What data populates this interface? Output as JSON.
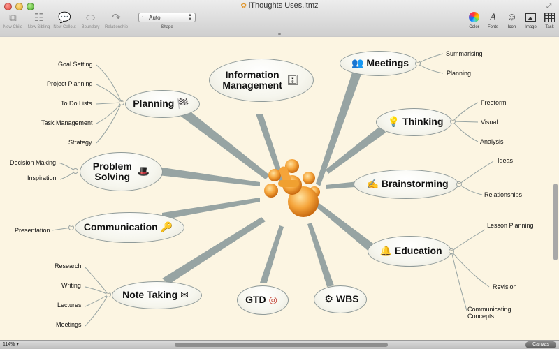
{
  "window": {
    "title": "iThoughts Uses.itmz"
  },
  "toolbar": {
    "left_tools": [
      {
        "id": "new-child",
        "label": "New Child",
        "icon": "new-child-icon",
        "glyph": "⧉"
      },
      {
        "id": "new-sibling",
        "label": "New Sibling",
        "icon": "new-sibling-icon",
        "glyph": "☷"
      },
      {
        "id": "new-callout",
        "label": "New Callout",
        "icon": "callout-icon",
        "glyph": "💬"
      },
      {
        "id": "boundary",
        "label": "Boundary",
        "icon": "boundary-icon",
        "glyph": "⬭"
      },
      {
        "id": "relationship",
        "label": "Relationship",
        "icon": "relationship-icon",
        "glyph": "↷"
      }
    ],
    "shape": {
      "value": "Auto",
      "label": "Shape"
    },
    "right_tools": [
      {
        "id": "color",
        "label": "Color",
        "icon": "color-wheel-icon"
      },
      {
        "id": "fonts",
        "label": "Fonts",
        "icon": "fonts-icon",
        "glyph": "A"
      },
      {
        "id": "icon",
        "label": "Icon",
        "icon": "smiley-icon",
        "glyph": "☺"
      },
      {
        "id": "image",
        "label": "Image",
        "icon": "image-icon"
      },
      {
        "id": "task",
        "label": "Task",
        "icon": "task-grid-icon"
      }
    ]
  },
  "mindmap": {
    "center_icon": "ithoughts-logo-icon",
    "topics": [
      {
        "id": "information-management",
        "label": "Information Management",
        "icon": "database-icon",
        "glyph": "🗄"
      },
      {
        "id": "meetings",
        "label": "Meetings",
        "icon": "people-icon",
        "glyph": "👥",
        "children": [
          "Summarising",
          "Planning"
        ]
      },
      {
        "id": "thinking",
        "label": "Thinking",
        "icon": "lightbulb-icon",
        "glyph": "💡",
        "children": [
          "Freeform",
          "Visual",
          "Analysis"
        ]
      },
      {
        "id": "brainstorming",
        "label": "Brainstorming",
        "icon": "pencil-icon",
        "glyph": "✍",
        "children": [
          "Ideas",
          "Relationships"
        ]
      },
      {
        "id": "education",
        "label": "Education",
        "icon": "bell-icon",
        "glyph": "🔔",
        "children": [
          "Lesson Planning",
          "Revision",
          "Communicating Concepts"
        ]
      },
      {
        "id": "wbs",
        "label": "WBS",
        "icon": "gear-icon",
        "glyph": "⚙"
      },
      {
        "id": "gtd",
        "label": "GTD",
        "icon": "target-icon",
        "glyph": "◎"
      },
      {
        "id": "note-taking",
        "label": "Note Taking",
        "icon": "envelope-icon",
        "glyph": "✉",
        "children": [
          "Research",
          "Writing",
          "Lectures",
          "Meetings"
        ]
      },
      {
        "id": "communication",
        "label": "Communication",
        "icon": "key-icon",
        "glyph": "🔑",
        "children": [
          "Presentation"
        ]
      },
      {
        "id": "problem-solving",
        "label": "Problem Solving",
        "icon": "bowler-hat-icon",
        "glyph": "🎩",
        "children": [
          "Decision Making",
          "Inspiration"
        ]
      },
      {
        "id": "planning",
        "label": "Planning",
        "icon": "checkered-flag-icon",
        "glyph": "🏁",
        "children": [
          "Goal Setting",
          "Project Planning",
          "To Do Lists",
          "Task Management",
          "Strategy"
        ]
      }
    ],
    "collapse_symbol": "−"
  },
  "statusbar": {
    "zoom": "114%",
    "zoom_arrow": "▾",
    "mode_button": "Canvas"
  },
  "colors": {
    "canvas": "#fcf5e2",
    "connector": "#97a4a3",
    "node_border": "#8f9a99",
    "center_orange": "#f0a030"
  }
}
